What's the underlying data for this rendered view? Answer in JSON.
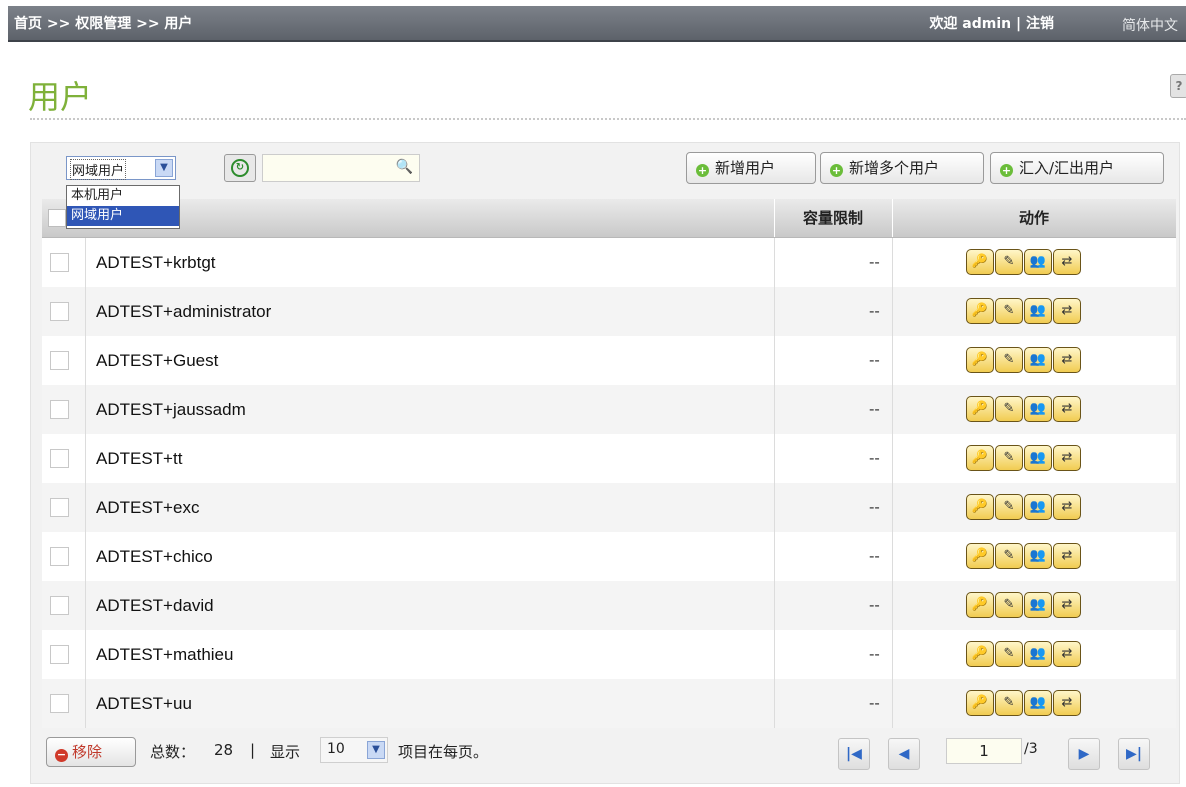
{
  "header": {
    "breadcrumb": "首页 >> 权限管理 >> 用户",
    "welcome": "欢迎 admin | 注销",
    "language": "简体中文"
  },
  "page": {
    "title": "用户",
    "help_icon": "question-icon"
  },
  "toolbar": {
    "user_type_selected": "网域用户",
    "user_type_options": [
      "本机用户",
      "网域用户"
    ],
    "search_placeholder": "",
    "buttons": {
      "add_user": "新增用户",
      "add_multiple": "新增多个用户",
      "import_export": "汇入/汇出用户"
    }
  },
  "table": {
    "columns": {
      "name": "",
      "quota": "容量限制",
      "actions": "动作"
    },
    "rows": [
      {
        "name": "ADTEST+krbtgt",
        "quota": "--"
      },
      {
        "name": "ADTEST+administrator",
        "quota": "--"
      },
      {
        "name": "ADTEST+Guest",
        "quota": "--"
      },
      {
        "name": "ADTEST+jaussadm",
        "quota": "--"
      },
      {
        "name": "ADTEST+tt",
        "quota": "--"
      },
      {
        "name": "ADTEST+exc",
        "quota": "--"
      },
      {
        "name": "ADTEST+chico",
        "quota": "--"
      },
      {
        "name": "ADTEST+david",
        "quota": "--"
      },
      {
        "name": "ADTEST+mathieu",
        "quota": "--"
      },
      {
        "name": "ADTEST+uu",
        "quota": "--"
      }
    ],
    "action_icons": [
      "password-key-icon",
      "edit-icon",
      "user-group-icon",
      "quota-icon"
    ]
  },
  "footer": {
    "remove_label": "移除",
    "total_label": "总数：",
    "total_value": "28",
    "separator": "|",
    "show_label": "显示",
    "per_page": "10",
    "per_page_suffix": "项目在每页。",
    "current_page": "1",
    "total_pages": "/3"
  }
}
